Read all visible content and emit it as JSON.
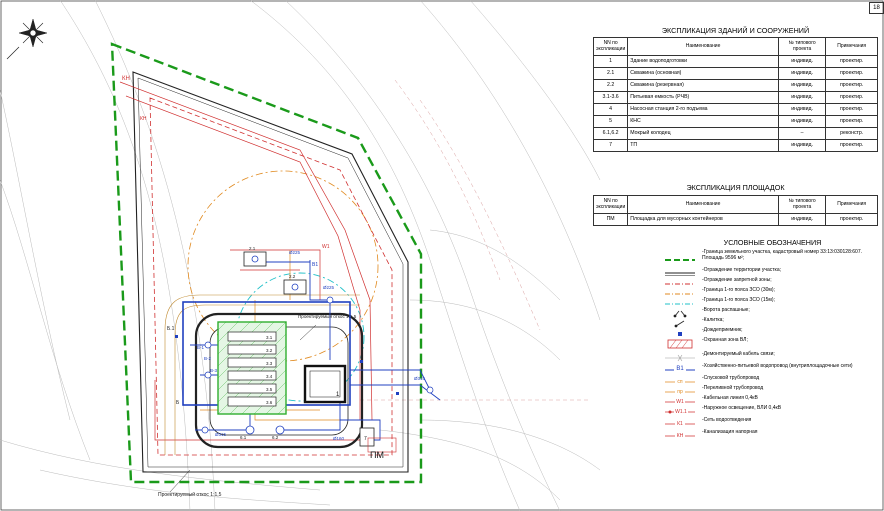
{
  "page_number": "18",
  "buildings": {
    "title": "ЭКСПЛИКАЦИЯ ЗДАНИЙ И СООРУЖЕНИЙ",
    "headers": [
      "NN по экспликации",
      "Наименование",
      "№ типового проекта",
      "Примечания"
    ],
    "rows": [
      [
        "1",
        "Здание водоподготовки",
        "индивид.",
        "проектир."
      ],
      [
        "2.1",
        "Скважина (основная)",
        "индивид.",
        "проектир."
      ],
      [
        "2.2",
        "Скважина (резервная)",
        "индивид.",
        "проектир."
      ],
      [
        "3.1-3.6",
        "Питьевая емкость (РЧВ)",
        "индивид.",
        "проектир."
      ],
      [
        "4",
        "Насосная станция 2-го подъема",
        "индивид.",
        "проектир."
      ],
      [
        "5",
        "КНС",
        "индивид.",
        "проектир."
      ],
      [
        "6.1,6.2",
        "Мокрый колодец",
        "–",
        "реконстр."
      ],
      [
        "7",
        "ТП",
        "индивид.",
        "проектир."
      ]
    ]
  },
  "sites": {
    "title": "ЭКСПЛИКАЦИЯ ПЛОЩАДОК",
    "headers": [
      "NN по экспликации",
      "Наименование",
      "№ типового проекта",
      "Примечания"
    ],
    "rows": [
      [
        "ПМ",
        "Площадка для мусорных контейнеров",
        "индивид.",
        "проектир."
      ]
    ]
  },
  "legend": {
    "title": "УСЛОВНЫЕ ОБОЗНАЧЕНИЯ",
    "items": [
      {
        "label": "-Граница земельного участка, кадастровый номер 33:13:030128:607. Площадь 9596 м²;",
        "symbol": "green-dash",
        "color": "#1a9a1a"
      },
      {
        "label": "-Ограждение территории участка;",
        "symbol": "double-line",
        "color": "#222222"
      },
      {
        "label": "-Ограждение запретной зоны;",
        "symbol": "red-dash",
        "color": "#d03030"
      },
      {
        "label": "-Граница 1-го пояса ЗСО (30м);",
        "symbol": "orange-dash",
        "color": "#e08a20"
      },
      {
        "label": "-Граница 1-го пояса ЗСО (15м);",
        "symbol": "cyan-dash",
        "color": "#20c0c8"
      },
      {
        "label": "-Ворота распашные;",
        "symbol": "gate"
      },
      {
        "label": "-Калитка;",
        "symbol": "wicket"
      },
      {
        "label": "-Дождеприемник;",
        "symbol": "drain"
      },
      {
        "label": "-Охранная зона ВЛ;",
        "symbol": "hatch-box",
        "color": "#d03030"
      },
      {
        "label": "-Демонтируемый кабель связи;",
        "symbol": "x-line",
        "color": "#999999"
      },
      {
        "label": "-Хозяйственно-питьевой водопровод (внутриплощадочные сети)",
        "symbol": "water",
        "code": "В1",
        "color": "#2040c0"
      },
      {
        "label": "-Спусковой трубопровод",
        "symbol": "coded",
        "code": "сп",
        "color": "#e08a20"
      },
      {
        "label": "-Переливной трубопровод",
        "symbol": "coded",
        "code": "пр",
        "color": "#e08a20"
      },
      {
        "label": "-Кабельная линия 0,4кВ",
        "symbol": "coded",
        "code": "W1",
        "color": "#d03030"
      },
      {
        "label": "-Наружное освещение, ВЛИ 0,4кВ",
        "symbol": "light",
        "code": "W1.1",
        "color": "#d03030"
      },
      {
        "label": "-Сеть водоотведения",
        "symbol": "coded",
        "code": "К1",
        "color": "#d03030"
      },
      {
        "label": "-Канализация напорная",
        "symbol": "coded",
        "code": "КН",
        "color": "#d03030"
      }
    ]
  },
  "plan": {
    "labels": [
      {
        "text": "Проектируемый откос 1:1,5",
        "kind": "note"
      },
      {
        "text": "Проектируемый откос 1:1,5",
        "kind": "note"
      },
      {
        "text": "ПМ",
        "kind": "site"
      },
      {
        "text": "1",
        "kind": "building"
      },
      {
        "text": "7",
        "kind": "building"
      },
      {
        "text": "3.1",
        "kind": "building"
      },
      {
        "text": "3.2",
        "kind": "building"
      },
      {
        "text": "3.3",
        "kind": "building"
      },
      {
        "text": "3.4",
        "kind": "building"
      },
      {
        "text": "3.5",
        "kind": "building"
      },
      {
        "text": "3.6",
        "kind": "building"
      },
      {
        "text": "6.1",
        "kind": "building"
      },
      {
        "text": "6.2",
        "kind": "building"
      },
      {
        "text": "2.1",
        "kind": "building"
      },
      {
        "text": "2.2",
        "kind": "building"
      },
      {
        "text": "КН",
        "kind": "net"
      },
      {
        "text": "КН",
        "kind": "net"
      },
      {
        "text": "W1",
        "kind": "net"
      },
      {
        "text": "В1",
        "kind": "net"
      },
      {
        "text": "В-1",
        "kind": "net"
      },
      {
        "text": "В-2",
        "kind": "net"
      },
      {
        "text": "В-3",
        "kind": "net"
      },
      {
        "text": "Б.1",
        "kind": "net"
      },
      {
        "text": "Б",
        "kind": "net"
      },
      {
        "text": "Ø225",
        "kind": "pipe"
      },
      {
        "text": "Ø225",
        "kind": "pipe"
      },
      {
        "text": "Ø315",
        "kind": "pipe"
      },
      {
        "text": "Ø160",
        "kind": "pipe"
      },
      {
        "text": "Ø315",
        "kind": "pipe"
      }
    ]
  },
  "colors": {
    "boundary": "#1a9a1a",
    "fence": "#222222",
    "restricted": "#d03030",
    "zone30": "#e08a20",
    "zone15": "#20c0c8",
    "water": "#2040c0",
    "reservoir": "#2fae2f"
  }
}
